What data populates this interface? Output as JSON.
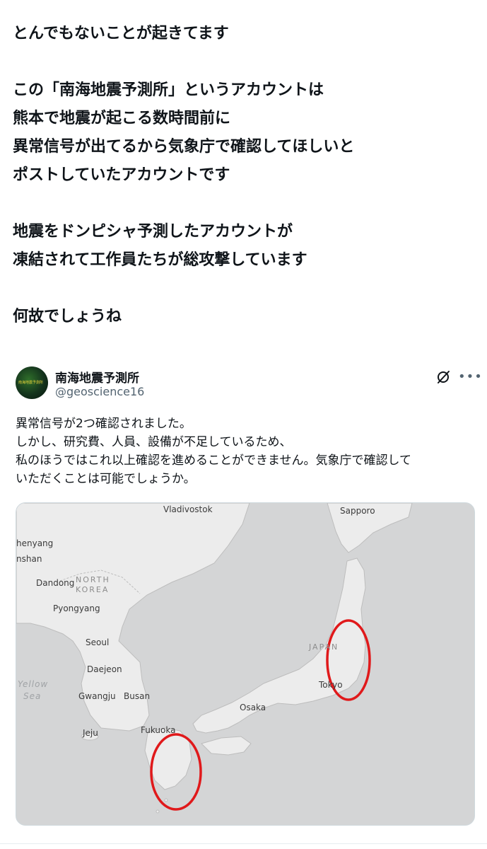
{
  "post": {
    "lines": [
      "とんでもないことが起きてます",
      "",
      "この「南海地震予測所」というアカウントは",
      "熊本で地震が起こる数時間前に",
      "異常信号が出てるから気象庁で確認してほしいと",
      "ポストしていたアカウントです",
      "",
      "地震をドンピシャ予測したアカウントが",
      "凍結されて工作員たちが総攻撃しています",
      "",
      "何故でしょうね"
    ]
  },
  "quoted": {
    "avatar_text": "南海地震予測所",
    "name": "南海地震予測所",
    "handle": "@geoscience16",
    "grok_icon": "grok-icon",
    "more_icon": "more-dots-icon",
    "text_lines": [
      "異常信号が2つ確認されました。",
      "しかし、研究費、人員、設備が不足しているため、",
      "私のほうではこれ以上確認を進めることができません。気象庁で確認して",
      "いただくことは可能でしょうか。"
    ],
    "map": {
      "labels": {
        "vladivostok": "Vladivostok",
        "sapporo": "Sapporo",
        "shenyang": "henyang",
        "anshan": "nshan",
        "dandong": "Dandong",
        "north_korea_1": "NORTH",
        "north_korea_2": "KOREA",
        "pyongyang": "Pyongyang",
        "seoul": "Seoul",
        "daejeon": "Daejeon",
        "yellow_sea_1": "Yellow",
        "yellow_sea_2": "Sea",
        "gwangju": "Gwangju",
        "busan": "Busan",
        "jeju": "Jeju",
        "fukuoka": "Fukuoka",
        "osaka": "Osaka",
        "japan": "JAPAN",
        "tokyo": "Tokyo"
      },
      "colors": {
        "land": "#ececec",
        "water": "#d4d5d6",
        "border": "#bdbdbd",
        "circle": "#e0191b"
      }
    }
  }
}
